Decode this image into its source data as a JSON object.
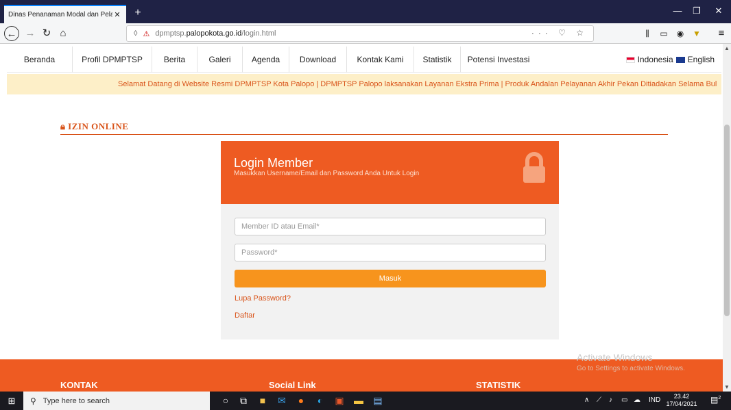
{
  "browser": {
    "tab_title": "Dinas Penanaman Modal dan Pelay",
    "url_domain": "palopokota.go.id",
    "url_prefix": "dpmptsp.",
    "url_path": "/login.html",
    "url_actions": "··· ♡ ☆"
  },
  "menu": {
    "items": [
      "Beranda",
      "Profil DPMPTSP",
      "Berita",
      "Galeri",
      "Agenda",
      "Download",
      "Kontak Kami",
      "Statistik",
      "Potensi Investasi"
    ],
    "lang_id": "Indonesia",
    "lang_en": "English"
  },
  "marquee": "Selamat Datang di Website Resmi DPMPTSP Kota Palopo  |  DPMPTSP Palopo laksanakan Layanan Ekstra Prima  |  Produk Andalan Pelayanan Akhir Pekan Ditiadakan Selama Bul",
  "section_title": "IZIN ONLINE",
  "login": {
    "title": "Login Member",
    "subtitle": "Masukkan Username/Email dan Password Anda Untuk Login",
    "member_placeholder": "Member ID atau Email*",
    "password_placeholder": "Password*",
    "submit_label": "Masuk",
    "forgot_label": "Lupa Password?",
    "register_label": "Daftar",
    "accent_color": "#ee5b22",
    "button_color": "#f7941d"
  },
  "footer": {
    "col1": "KONTAK",
    "col2": "Social Link",
    "col3": "STATISTIK"
  },
  "watermark": {
    "line1": "Activate Windows",
    "line2": "Go to Settings to activate Windows."
  },
  "taskbar": {
    "search_placeholder": "Type here to search",
    "lang": "IND",
    "time": "23.42",
    "date": "17/04/2021",
    "notif_count": "2"
  }
}
